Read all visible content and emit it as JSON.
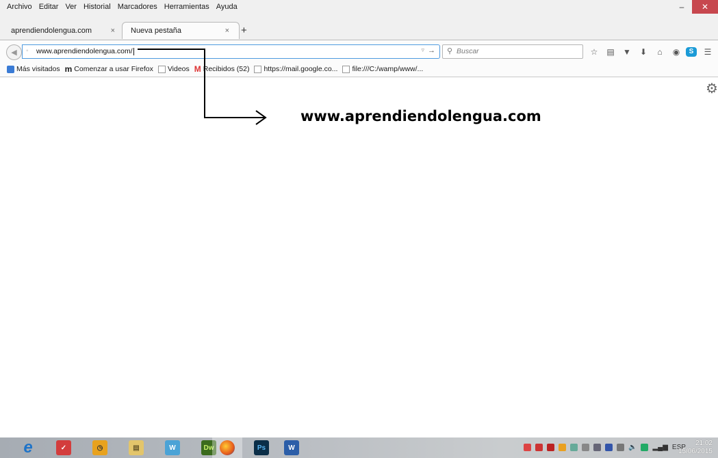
{
  "menubar": {
    "items": [
      "Archivo",
      "Editar",
      "Ver",
      "Historial",
      "Marcadores",
      "Herramientas",
      "Ayuda"
    ],
    "minimize": "–",
    "restore": "❐",
    "close": "✕"
  },
  "tabs": [
    {
      "title": "aprendiendolengua.com",
      "close": "×"
    },
    {
      "title": "Nueva pestaña",
      "close": "×"
    }
  ],
  "new_tab": "+",
  "navbar": {
    "url": "www.aprendiendolengua.com/",
    "search_placeholder": "Buscar"
  },
  "bookmarks": [
    {
      "label": "Más visitados",
      "icon": "blue-bookmark-icon"
    },
    {
      "label": "Comenzar a usar Firefox",
      "icon": "mozilla-m-icon"
    },
    {
      "label": "Videos",
      "icon": "page-icon"
    },
    {
      "label": "Recibidos (52)",
      "icon": "gmail-icon"
    },
    {
      "label": "https://mail.google.co...",
      "icon": "page-icon"
    },
    {
      "label": "file:///C:/wamp/www/...",
      "icon": "page-icon"
    }
  ],
  "annotation": {
    "text": "www.aprendiendolengua.com"
  },
  "taskbar": {
    "apps": [
      "internet-explorer",
      "todoist",
      "dashboard",
      "file-explorer",
      "word-alt",
      "dreamweaver",
      "firefox",
      "photoshop",
      "word"
    ],
    "dw_label": "Dw",
    "ps_label": "Ps",
    "word_label": "W",
    "lang": "ESP",
    "time": "21:02",
    "date": "15/06/2015"
  }
}
